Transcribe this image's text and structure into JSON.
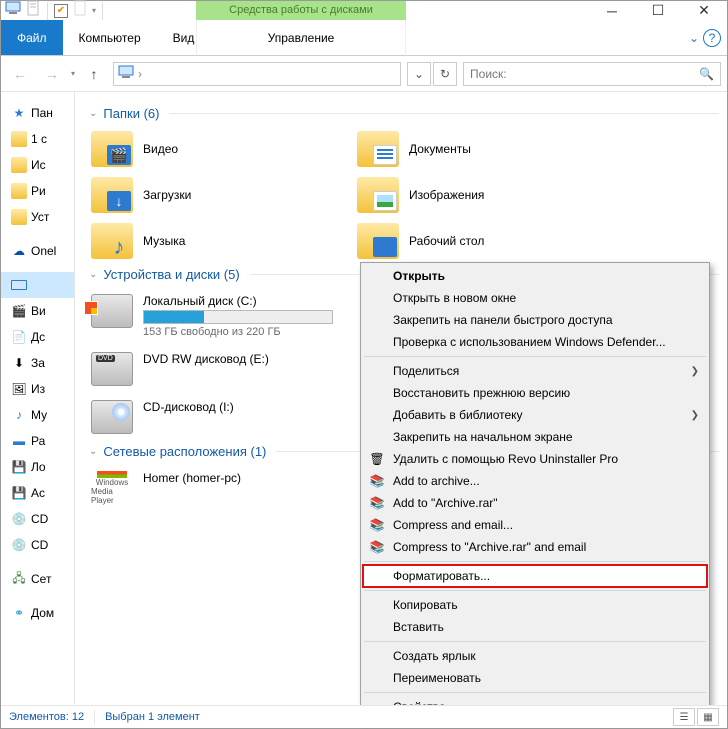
{
  "window": {
    "ctx_header": "Средства работы с дисками",
    "ctx_tab": "Управление"
  },
  "ribbon": {
    "file": "Файл",
    "computer": "Компьютер",
    "view": "Вид"
  },
  "address": {
    "search_placeholder": "Поиск:"
  },
  "nav": {
    "panel": "Пан",
    "c1": "1 с",
    "is": "Ис",
    "ri": "Ри",
    "ust": "Уст",
    "one": "Onel",
    "vi": "Ви",
    "do": "Дс",
    "za": "За",
    "iz": "Из",
    "mu": "Му",
    "ra": "Ра",
    "lo": "Ло",
    "ac": "Ас",
    "cd1": "CD",
    "cd2": "CD",
    "set": "Сет",
    "dom": "Дом"
  },
  "groups": {
    "folders": "Папки (6)",
    "drives": "Устройства и диски (5)",
    "network": "Сетевые расположения (1)"
  },
  "folders": {
    "video": "Видео",
    "documents": "Документы",
    "downloads": "Загрузки",
    "pictures": "Изображения",
    "music": "Музыка",
    "desktop": "Рабочий стол"
  },
  "drives": {
    "c_name": "Локальный диск (C:)",
    "c_info": "153 ГБ свободно из 220 ГБ",
    "dvd_name": "DVD RW дисковод (E:)",
    "cd_name": "CD-дисковод (I:)"
  },
  "network": {
    "homer": "Homer (homer-pc)"
  },
  "netlabel": {
    "win": "Windows",
    "mp": "Media Player"
  },
  "context": {
    "open": "Открыть",
    "open_new": "Открыть в новом окне",
    "pin_quick": "Закрепить на панели быстрого доступа",
    "defender": "Проверка с использованием Windows Defender...",
    "share": "Поделиться",
    "restore": "Восстановить прежнюю версию",
    "library": "Добавить в библиотеку",
    "pin_start": "Закрепить на начальном экране",
    "revo": "Удалить с помощью Revo Uninstaller Pro",
    "add_archive": "Add to archive...",
    "add_rar": "Add to \"Archive.rar\"",
    "comp_email": "Compress and email...",
    "comp_rar_email": "Compress to \"Archive.rar\" and email",
    "format": "Форматировать...",
    "copy": "Копировать",
    "paste": "Вставить",
    "shortcut": "Создать ярлык",
    "rename": "Переименовать",
    "properties": "Свойства"
  },
  "status": {
    "count": "Элементов: 12",
    "selected": "Выбран 1 элемент"
  }
}
